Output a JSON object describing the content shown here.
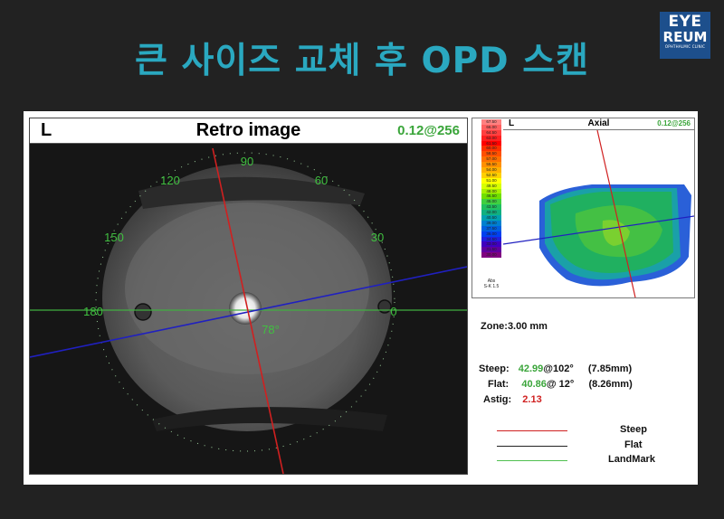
{
  "slide": {
    "title": "큰 사이즈 교체 후 OPD 스캔"
  },
  "logo": {
    "line1": "EYE",
    "line2": "REUM",
    "line3": "OPHTHALMIC CLINIC"
  },
  "retro": {
    "eye": "L",
    "title": "Retro image",
    "value": "0.12@256",
    "angles": [
      "90",
      "60",
      "30",
      "0",
      "120",
      "150",
      "180"
    ],
    "angle_mark": "78°"
  },
  "axial": {
    "eye": "L",
    "title": "Axial",
    "value": "0.12@256",
    "scale": [
      "67.50",
      "66.00",
      "64.50",
      "63.00",
      "61.50",
      "60.00",
      "58.50",
      "57.00",
      "55.50",
      "54.00",
      "52.50",
      "51.00",
      "49.50",
      "48.00",
      "46.50",
      "45.00",
      "43.50",
      "42.00",
      "40.50",
      "39.00",
      "37.50",
      "36.00",
      "34.50",
      "33.00",
      "31.50",
      "30.00"
    ],
    "scale_colors": [
      "#ff8080",
      "#ff6060",
      "#ff4040",
      "#ff2020",
      "#ff0000",
      "#ff3000",
      "#ff5000",
      "#ff7000",
      "#ff9000",
      "#ffb000",
      "#ffd000",
      "#ffff00",
      "#d8ff00",
      "#a8f000",
      "#70e000",
      "#40d040",
      "#20c060",
      "#10b080",
      "#00a0b0",
      "#0080d0",
      "#0060e0",
      "#0040f0",
      "#2020e0",
      "#4000c0",
      "#6000a0",
      "#800080"
    ],
    "scale_foot": [
      "Abs",
      "S-K 1.5"
    ]
  },
  "stats": {
    "zone": "Zone:3.00 mm",
    "steep_label": "Steep:",
    "steep_value": "42.99",
    "steep_rest": "@102°",
    "steep_mm": "(7.85mm)",
    "flat_label": "Flat:",
    "flat_value": "40.86",
    "flat_rest": "@ 12°",
    "flat_mm": "(8.26mm)",
    "astig_label": "Astig:",
    "astig_value": "2.13"
  },
  "legend": [
    {
      "label": "Steep",
      "color": "#d02020"
    },
    {
      "label": "Flat",
      "color": "#222222"
    },
    {
      "label": "LandMark",
      "color": "#50c050"
    }
  ]
}
